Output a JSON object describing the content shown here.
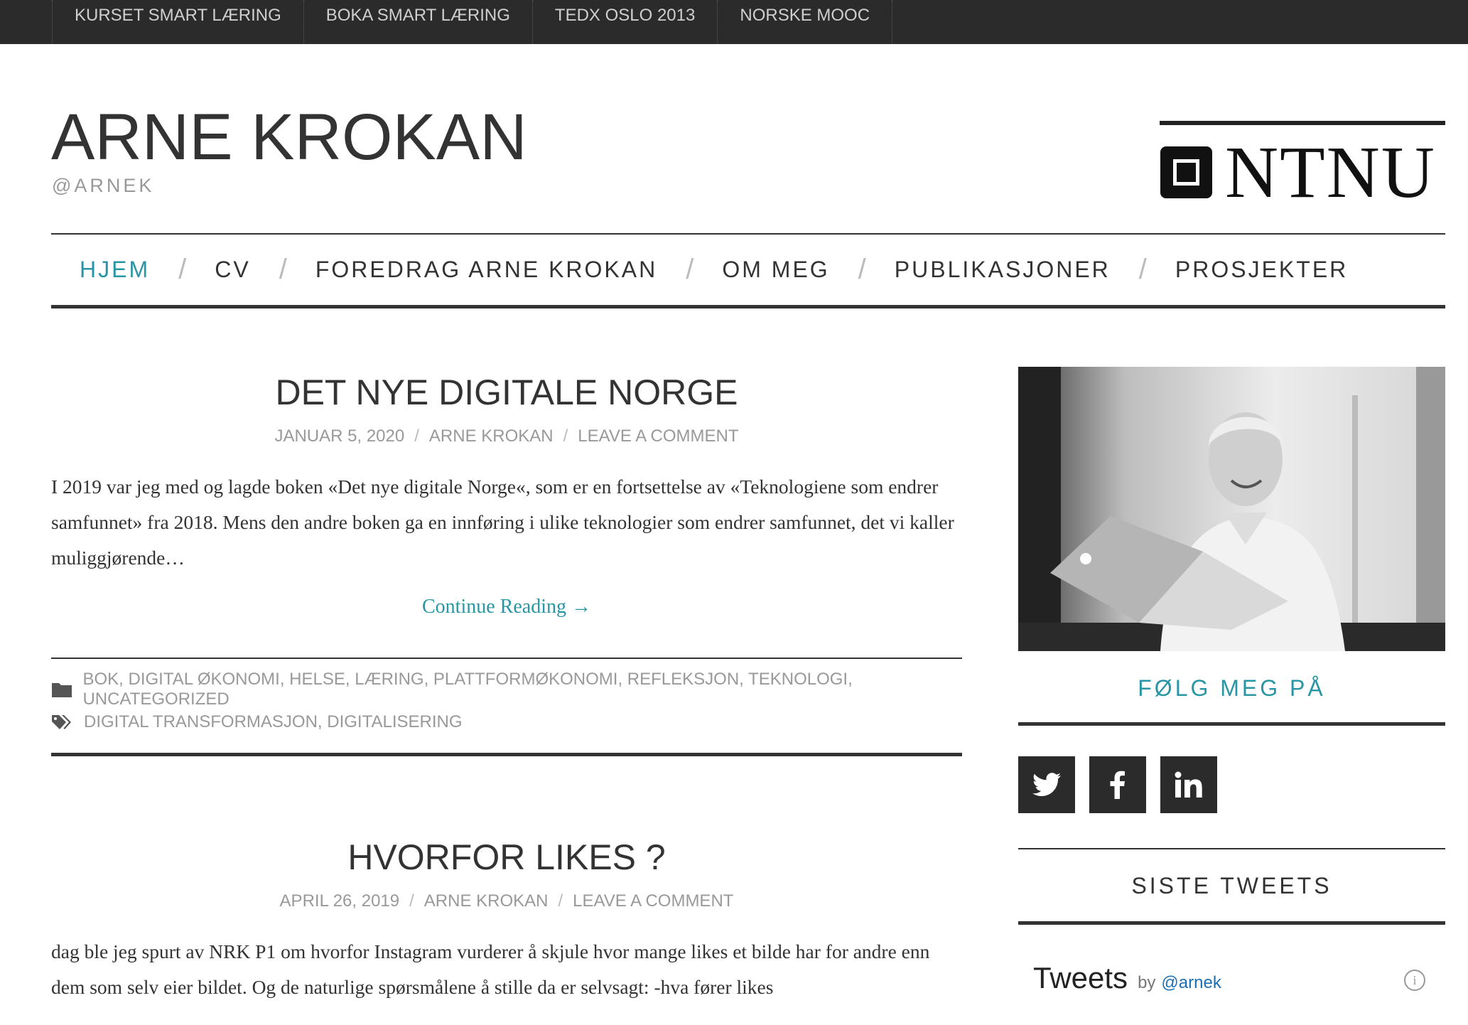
{
  "topbar": {
    "items": [
      "KURSET SMART LÆRING",
      "BOKA SMART LÆRING",
      "TEDX OSLO 2013",
      "NORSKE MOOC"
    ]
  },
  "header": {
    "title": "ARNE KROKAN",
    "tagline": "@ARNEK",
    "logo_text": "NTNU"
  },
  "nav": {
    "items": [
      "HJEM",
      "CV",
      "FOREDRAG ARNE KROKAN",
      "OM MEG",
      "PUBLIKASJONER",
      "PROSJEKTER"
    ],
    "separator": "/",
    "active_index": 0
  },
  "posts": [
    {
      "title": "DET NYE DIGITALE NORGE",
      "date": "JANUAR 5, 2020",
      "author": "ARNE KROKAN",
      "comments": "LEAVE A COMMENT",
      "excerpt": "I 2019 var jeg med og lagde boken «Det nye digitale Norge«, som er en fortsettelse av «Teknologiene som endrer samfunnet» fra 2018. Mens den andre boken ga en innføring i ulike teknologier som endrer samfunnet, det vi kaller muliggjørende…",
      "read_more": "Continue Reading →",
      "categories": "BOK, DIGITAL ØKONOMI, HELSE, LÆRING, PLATTFORMØKONOMI, REFLEKSJON, TEKNOLOGI, UNCATEGORIZED",
      "tags": "DIGITAL TRANSFORMASJON, DIGITALISERING"
    },
    {
      "title": "HVORFOR LIKES ?",
      "date": "APRIL 26, 2019",
      "author": "ARNE KROKAN",
      "comments": "LEAVE A COMMENT",
      "excerpt": "dag ble jeg spurt av NRK P1 om hvorfor Instagram vurderer å skjule hvor mange likes et bilde har for andre enn dem som selv eier bildet. Og de naturlige spørsmålene å stille da er selvsagt: -hva fører likes"
    }
  ],
  "sidebar": {
    "follow_title": "FØLG MEG PÅ",
    "social": [
      "twitter-icon",
      "facebook-icon",
      "linkedin-icon"
    ],
    "tweets_title": "SISTE TWEETS",
    "tweets_label": "Tweets",
    "tweets_by": "by",
    "tweets_handle": "@arnek"
  },
  "colors": {
    "accent": "#2996a6",
    "topbar_bg": "#2b2b2b",
    "text": "#333333",
    "meta": "#999999"
  }
}
